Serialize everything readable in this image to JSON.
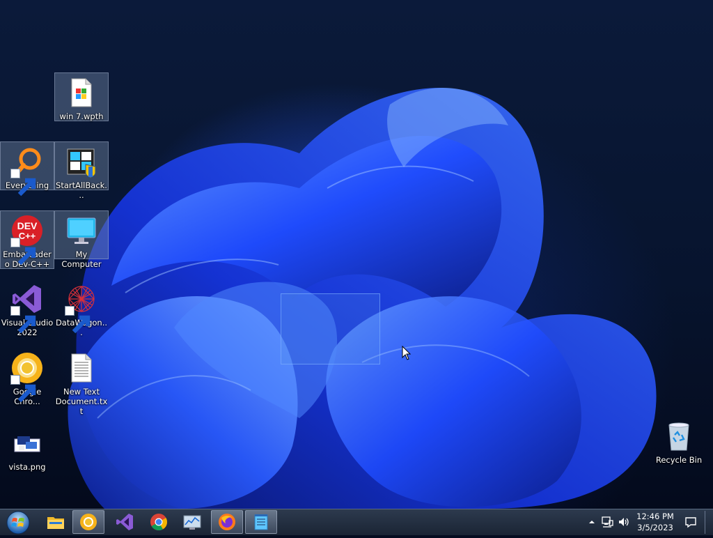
{
  "desktop_icons": [
    {
      "label": "win 7.wpth",
      "icon": "document-icon",
      "selected": true,
      "shortcut": false
    },
    {
      "label": "Everything",
      "icon": "magnifier-search-icon",
      "selected": true,
      "shortcut": true
    },
    {
      "label": "StartAllBack...",
      "icon": "startallback-icon",
      "selected": true,
      "shortcut": false
    },
    {
      "label": "Embarcadero Dev-C++",
      "icon": "dev-cpp-icon",
      "selected": true,
      "shortcut": true
    },
    {
      "label": "My Computer",
      "icon": "monitor-icon",
      "selected": true,
      "shortcut": false
    },
    {
      "label": "Visual Studio 2022",
      "icon": "visual-studio-icon",
      "selected": false,
      "shortcut": true
    },
    {
      "label": "DataWagon...",
      "icon": "datawagon-icon",
      "selected": false,
      "shortcut": true
    },
    {
      "label": "Google Chro...",
      "icon": "chrome-canary-icon",
      "selected": false,
      "shortcut": true
    },
    {
      "label": "New Text Document.txt",
      "icon": "text-file-icon",
      "selected": false,
      "shortcut": false
    },
    {
      "label": "vista.png",
      "icon": "image-file-icon",
      "selected": false,
      "shortcut": false
    },
    {
      "label": "Recycle Bin",
      "icon": "recycle-bin-icon",
      "selected": false,
      "shortcut": false
    }
  ],
  "dev_icon_text": {
    "top": "DEV",
    "bottom": "C++"
  },
  "taskbar": {
    "start": "windows-orb-icon",
    "pinned": [
      {
        "name": "file-explorer",
        "icon": "folder-icon",
        "active": false
      },
      {
        "name": "chrome-canary",
        "icon": "chrome-canary-icon",
        "active": true
      },
      {
        "name": "visual-studio",
        "icon": "visual-studio-icon",
        "active": false
      },
      {
        "name": "chrome",
        "icon": "chrome-icon",
        "active": false
      },
      {
        "name": "resource-monitor",
        "icon": "monitor-graph-icon",
        "active": false
      },
      {
        "name": "firefox",
        "icon": "firefox-icon",
        "active": true
      },
      {
        "name": "notepad",
        "icon": "notepad-icon",
        "active": true
      }
    ],
    "tray": [
      "chevron-up-icon",
      "network-icon",
      "volume-icon"
    ],
    "clock": {
      "time": "12:46 PM",
      "date": "3/5/2023"
    },
    "notification": "action-center-icon"
  },
  "colors": {
    "accent_blue": "#2f5bff",
    "taskbar": "#1e2838",
    "selection": "#5a8ce6"
  }
}
